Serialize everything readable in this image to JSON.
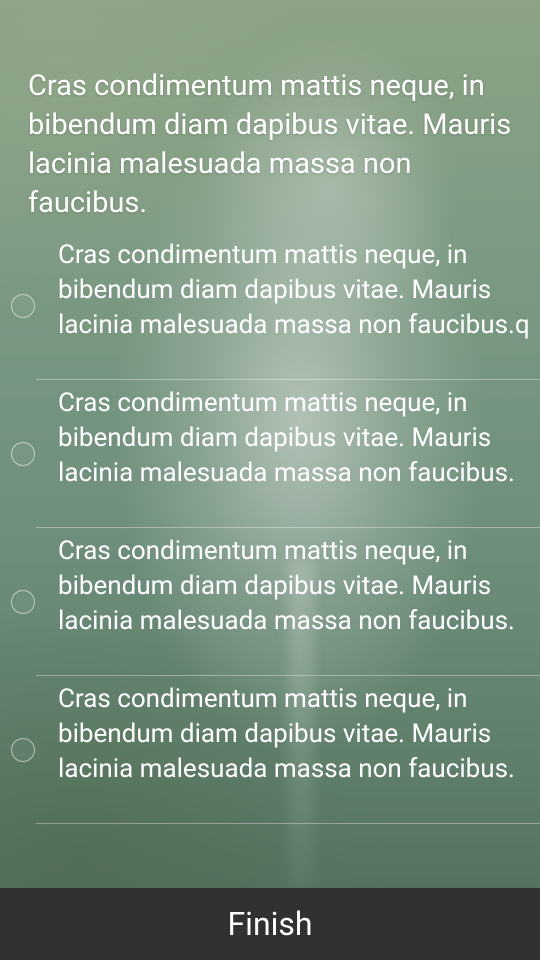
{
  "question": {
    "text": "Cras condimentum mattis neque, in bibendum diam dapibus vitae. Mauris lacinia malesuada massa non faucibus."
  },
  "options": [
    {
      "label": "Cras condimentum mattis neque, in bibendum diam dapibus vitae. Mauris lacinia malesuada massa non faucibus.q",
      "selected": false
    },
    {
      "label": "Cras condimentum mattis neque, in bibendum diam dapibus vitae. Mauris lacinia malesuada massa non faucibus.",
      "selected": false
    },
    {
      "label": "Cras condimentum mattis neque, in bibendum diam dapibus vitae. Mauris lacinia malesuada massa non faucibus.",
      "selected": false
    },
    {
      "label": "Cras condimentum mattis neque, in bibendum diam dapibus vitae. Mauris lacinia malesuada massa non faucibus.",
      "selected": false
    }
  ],
  "footer": {
    "finish_label": "Finish"
  },
  "colors": {
    "footer_background": "#2f3133",
    "text": "#ffffff",
    "background_tint": "#6f8f7c"
  }
}
